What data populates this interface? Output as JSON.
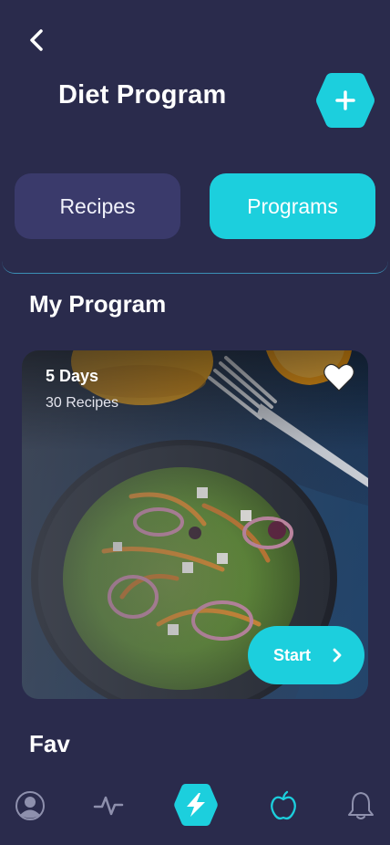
{
  "header": {
    "title": "Diet Program",
    "back_icon": "chevron-left-icon",
    "add_icon": "plus-icon"
  },
  "segments": {
    "recipes_label": "Recipes",
    "programs_label": "Programs",
    "active": "Programs"
  },
  "my_program": {
    "section_title": "My Program",
    "card": {
      "duration": "5 Days",
      "recipe_count": "30 Recipes",
      "favorite_icon": "heart-icon",
      "start_label": "Start",
      "start_icon": "chevron-right-icon"
    }
  },
  "fav": {
    "section_title": "Fav"
  },
  "bottom_nav": {
    "items": [
      "profile-icon",
      "activity-icon",
      "bolt-icon",
      "apple-icon",
      "bell-icon"
    ],
    "active": "bolt-icon"
  },
  "colors": {
    "background": "#2a2b4c",
    "accent": "#1ccfdd",
    "inactive_segment": "#3a3a6b"
  }
}
